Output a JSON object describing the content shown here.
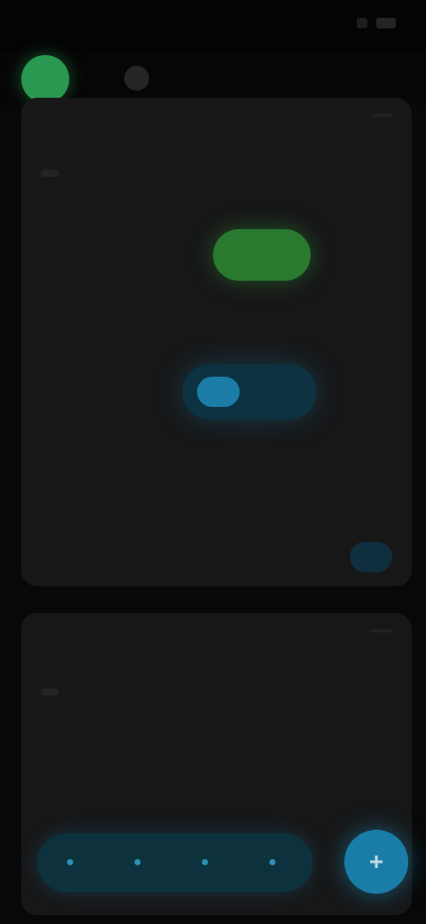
{
  "status_bar": {
    "time": "",
    "icons": [
      "signal-icon",
      "battery-icon"
    ]
  },
  "header": {
    "tabs": [
      {
        "label": ""
      },
      {
        "label": ""
      }
    ]
  },
  "card1": {
    "meta_left": "",
    "meta_right": "",
    "title_strong": "",
    "title_rest": "",
    "label_left": "",
    "green_pill": "",
    "blue_pill": "",
    "subtle": "",
    "small_button": ""
  },
  "card2": {
    "meta_left": "",
    "meta_right": "",
    "title_strong": "",
    "title_rest": "",
    "section_label": "",
    "controls": [
      {
        "icon": "circle-icon"
      },
      {
        "icon": "circle-icon"
      },
      {
        "icon": "circle-icon"
      },
      {
        "icon": "circle-icon"
      }
    ],
    "fab_icon": "plus-icon"
  },
  "colors": {
    "accent_green": "#2fae5c",
    "accent_blue": "#1d8fbf",
    "background": "#0a0a0a",
    "card": "#1b1b1c"
  }
}
